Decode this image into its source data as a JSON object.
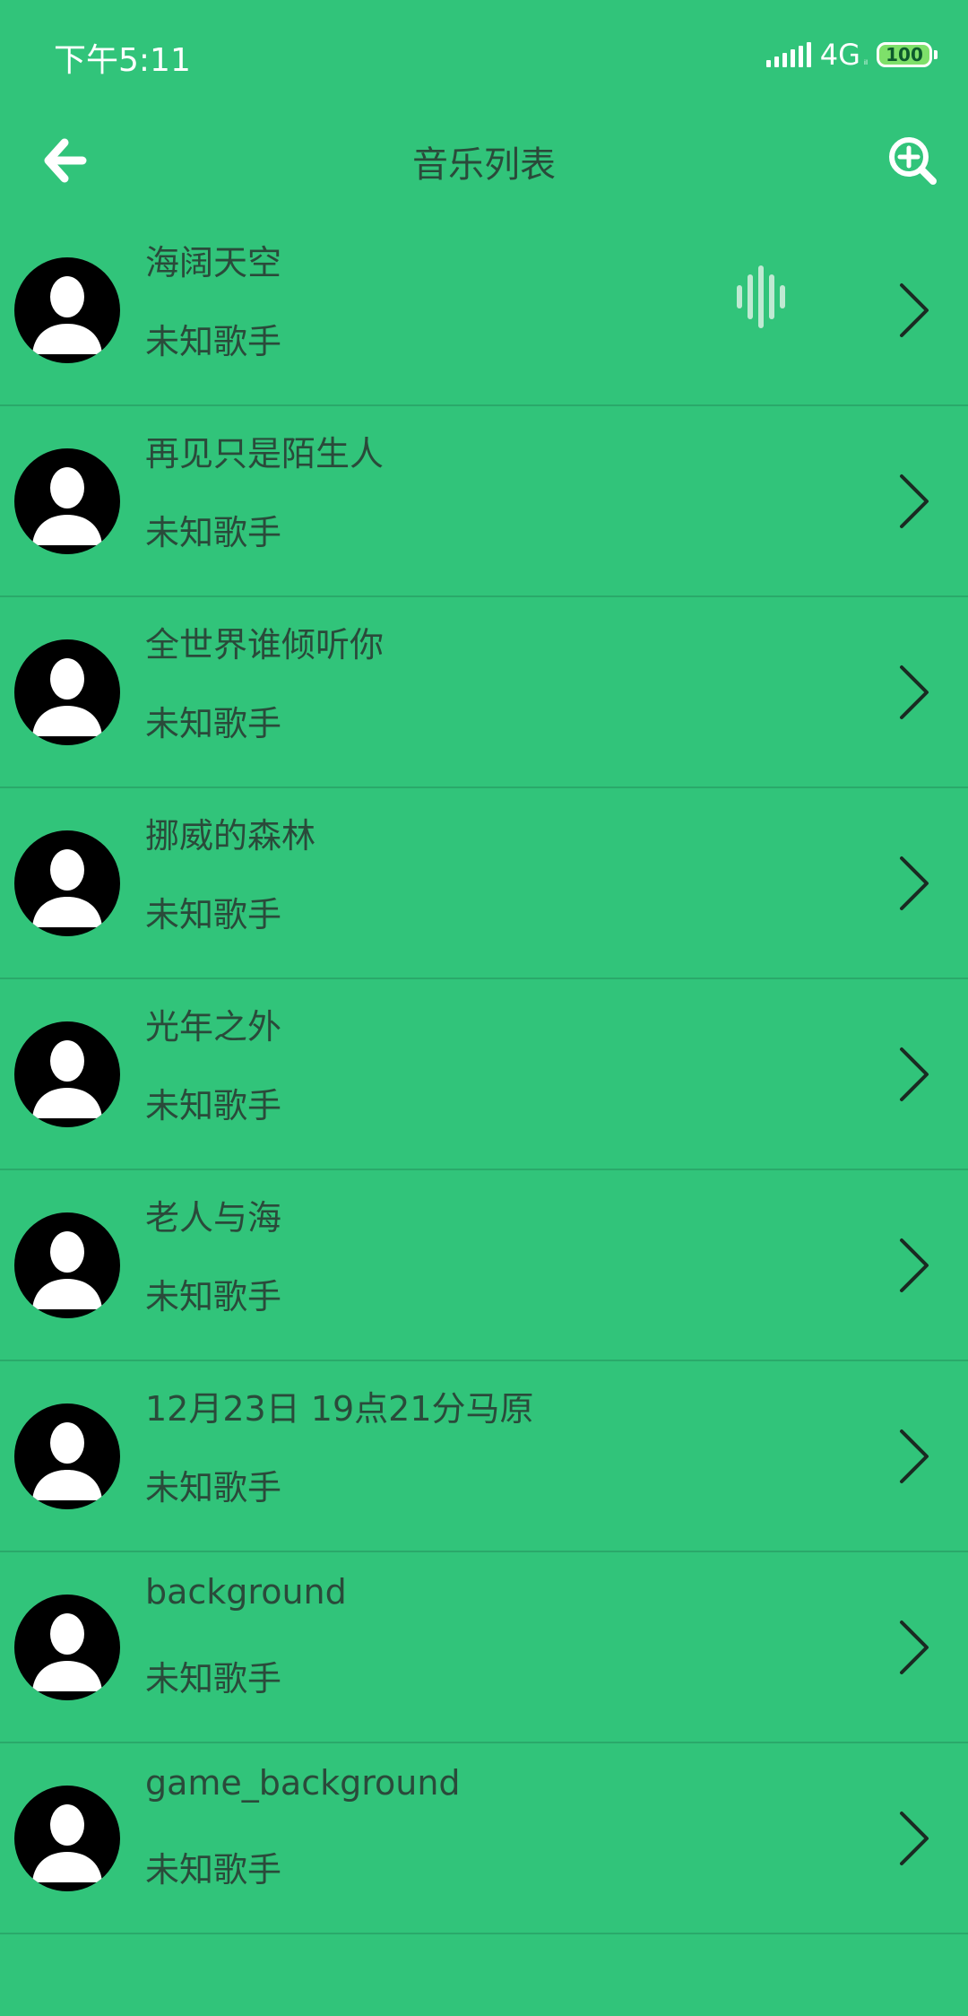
{
  "status_bar": {
    "time": "下午5:11",
    "network": "4G",
    "network_sub": "ᵢₗ",
    "battery": "100"
  },
  "app_bar": {
    "title": "音乐列表",
    "back_icon": "arrow-left-icon",
    "search_icon": "search-add-icon"
  },
  "songs": [
    {
      "title": "海阔天空",
      "artist": "未知歌手",
      "playing": true
    },
    {
      "title": "再见只是陌生人",
      "artist": "未知歌手",
      "playing": false
    },
    {
      "title": "全世界谁倾听你",
      "artist": "未知歌手",
      "playing": false
    },
    {
      "title": "挪威的森林",
      "artist": "未知歌手",
      "playing": false
    },
    {
      "title": "光年之外",
      "artist": "未知歌手",
      "playing": false
    },
    {
      "title": "老人与海",
      "artist": "未知歌手",
      "playing": false
    },
    {
      "title": "12月23日 19点21分马原",
      "artist": "未知歌手",
      "playing": false
    },
    {
      "title": "background",
      "artist": "未知歌手",
      "playing": false
    },
    {
      "title": "game_background",
      "artist": "未知歌手",
      "playing": false
    }
  ],
  "colors": {
    "background": "#31c47a",
    "text": "#2a4a3a",
    "divider": "#2aa96a",
    "avatar_bg": "#000000"
  }
}
